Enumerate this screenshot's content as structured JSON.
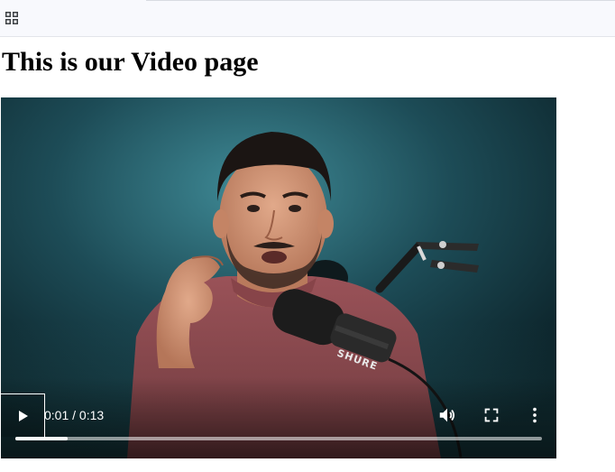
{
  "bookmarks_bar": {
    "apps_icon": "apps-grid-icon"
  },
  "page": {
    "title": "This is our Video page"
  },
  "video": {
    "current_time": "0:01",
    "duration": "0:13",
    "time_text": "0:01 / 0:13",
    "progress_fraction": 0.1,
    "icons": {
      "play": "play-icon",
      "volume": "volume-icon",
      "fullscreen": "fullscreen-icon",
      "more": "more-options-icon"
    },
    "mic_brand": "SHURE"
  }
}
